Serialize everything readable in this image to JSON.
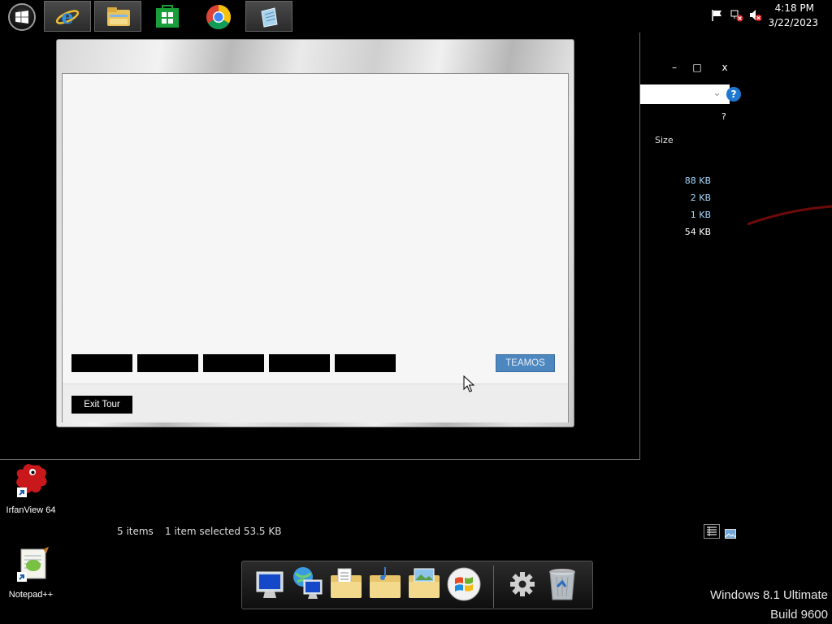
{
  "taskbar": {
    "apps": [
      {
        "name": "Internet Explorer",
        "icon": "internet-explorer-icon",
        "active": true
      },
      {
        "name": "File Explorer",
        "icon": "file-explorer-icon",
        "active": true
      },
      {
        "name": "Store",
        "icon": "store-icon",
        "active": false
      },
      {
        "name": "Google Chrome",
        "icon": "chrome-icon",
        "active": false
      },
      {
        "name": "Notepad",
        "icon": "notepad-icon",
        "active": true
      }
    ],
    "tray": {
      "icons": [
        "action-center-flag-icon",
        "network-error-icon",
        "volume-muted-icon"
      ],
      "time": "4:18 PM",
      "date": "3/22/2023"
    }
  },
  "explorer": {
    "window_controls": {
      "minimize": "–",
      "maximize": "□",
      "close": "x"
    },
    "help_label": "?",
    "column_header": "Size",
    "file_sizes": [
      "88 KB",
      "2 KB",
      "1 KB",
      "54 KB"
    ],
    "status": {
      "item_count": "5 items",
      "selection": "1 item selected  53.5 KB"
    }
  },
  "tour": {
    "tabs": [
      "",
      "",
      "",
      "",
      ""
    ],
    "teamos_label": "TEAMOS",
    "exit_label": "Exit Tour"
  },
  "desktop": {
    "icons": [
      {
        "label": "IrfanView 64",
        "icon": "irfanview-icon"
      },
      {
        "label": "Notepad++",
        "icon": "notepad-plus-plus-icon"
      }
    ]
  },
  "dock": {
    "items": [
      "computer-icon",
      "network-icon",
      "documents-folder-icon",
      "music-folder-icon",
      "pictures-folder-icon",
      "windows-logo-icon",
      "settings-gear-icon",
      "recycle-bin-icon"
    ]
  },
  "watermark": {
    "line1": "Windows 8.1 Ultimate",
    "line2": "Build 9600"
  },
  "colors": {
    "accent_button": "#4d87c0",
    "link_text": "#a8d8ff",
    "help_blue": "#1e78d2"
  }
}
